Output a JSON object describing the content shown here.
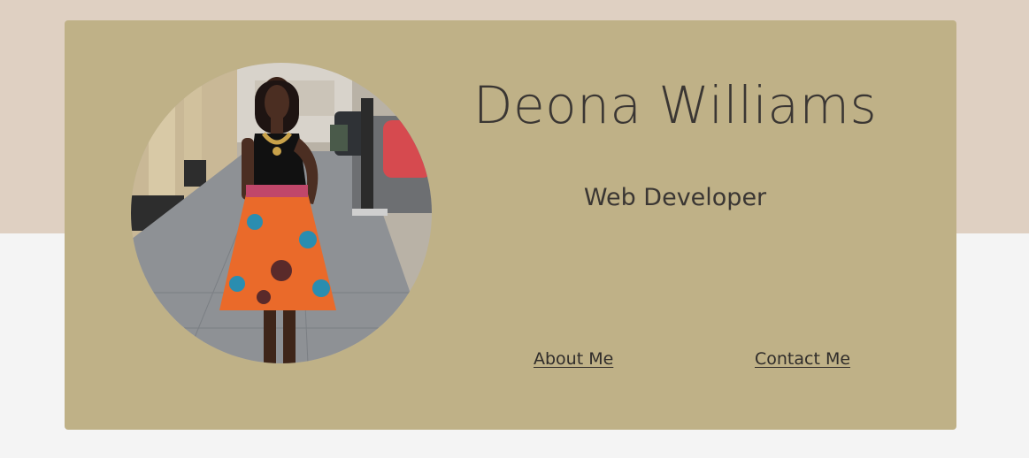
{
  "profile": {
    "name": "Deona Williams",
    "role": "Web Developer"
  },
  "nav": {
    "about_label": "About Me",
    "contact_label": "Contact Me"
  },
  "colors": {
    "top_band": "#dfd0c2",
    "page_background": "#f4f4f4",
    "card_background": "#bfb187",
    "text": "#3a3633"
  }
}
